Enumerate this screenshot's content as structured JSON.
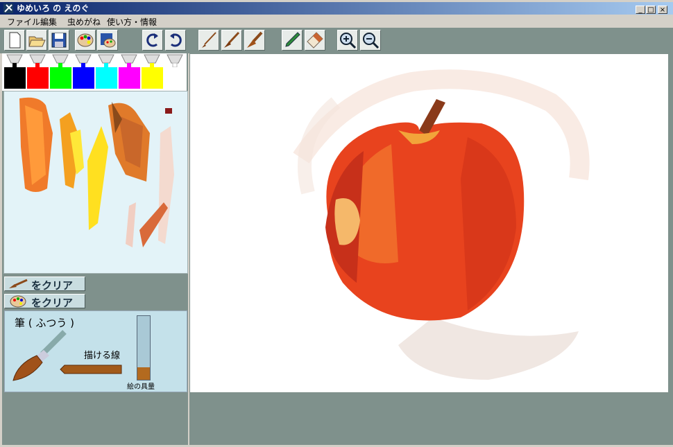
{
  "window": {
    "title": "ゆめいろ の えのぐ",
    "controls": {
      "minimize": "_",
      "maximize": "□",
      "close": "×"
    }
  },
  "menu": {
    "items": [
      "ファイル",
      "編集",
      "虫めがね",
      "使い方・情報"
    ]
  },
  "toolbar": {
    "buttons": [
      "new-icon",
      "open-icon",
      "save-icon",
      "palette-icon",
      "save-palette-icon",
      "undo-icon",
      "redo-icon",
      "thin-brush-icon",
      "medium-brush-icon",
      "thick-brush-icon",
      "pencil-icon",
      "eraser-icon",
      "zoom-in-icon",
      "zoom-out-icon"
    ]
  },
  "colors": {
    "swatches": [
      "#000000",
      "#ff0000",
      "#00ff00",
      "#0000ff",
      "#00ffff",
      "#ff00ff",
      "#ffff00",
      "#ffffff"
    ]
  },
  "clear_buttons": {
    "canvas_clear": "をクリア",
    "palette_clear": "をクリア"
  },
  "brush": {
    "name": "筆 ( ふつう )",
    "stroke_label": "描ける線",
    "paint_label": "絵の具量",
    "paint_level": 0.2,
    "paint_color": "#b36a1f"
  },
  "theme": {
    "panel_bg": "#7f918c",
    "palette_bg": "#e3f3f8",
    "brush_panel_bg": "#c4e1ea"
  }
}
